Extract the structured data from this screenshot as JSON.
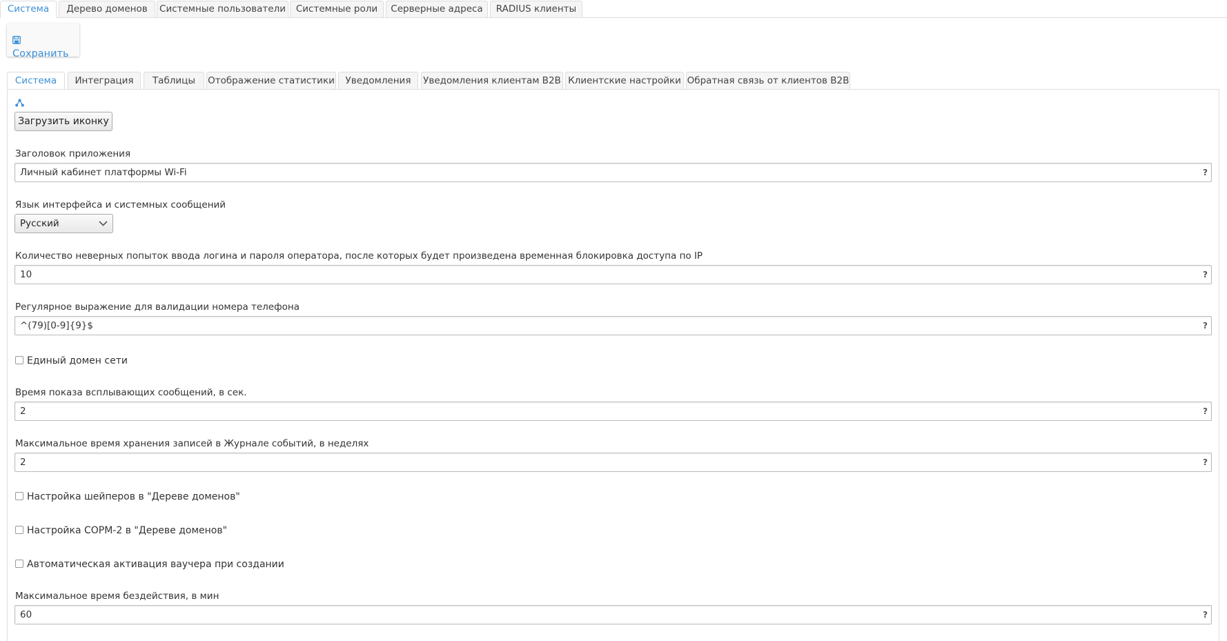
{
  "top_tabs": [
    "Система",
    "Дерево доменов",
    "Системные пользователи",
    "Системные роли",
    "Серверные адреса",
    "RADIUS клиенты"
  ],
  "toolbar": {
    "save_label": "Сохранить"
  },
  "sub_tabs": [
    "Система",
    "Интеграция",
    "Таблицы",
    "Отображение статистики",
    "Уведомления",
    "Уведомления клиентам B2B",
    "Клиентские настройки",
    "Обратная связь от клиентов B2B"
  ],
  "icon": {
    "upload_label": "Загрузить иконку"
  },
  "form": {
    "app_title": {
      "label": "Заголовок приложения",
      "value": "Личный кабинет платформы Wi-Fi"
    },
    "language": {
      "label": "Язык интерфейса и системных сообщений",
      "value": "Русский"
    },
    "login_attempts": {
      "label": "Количество неверных попыток ввода логина и пароля оператора, после которых будет произведена временная блокировка доступа по IP",
      "value": "10"
    },
    "phone_regex": {
      "label": "Регулярное выражение для валидации номера телефона",
      "value": "^(79)[0-9]{9}$"
    },
    "single_domain": {
      "label": "Единый домен сети",
      "checked": false
    },
    "popup_time": {
      "label": "Время показа всплывающих сообщений, в сек.",
      "value": "2"
    },
    "log_retention": {
      "label": "Максимальное время хранения записей в Журнале событий, в неделях",
      "value": "2"
    },
    "shapers": {
      "label": "Настройка шейперов в \"Дереве доменов\"",
      "checked": false
    },
    "sorm2": {
      "label": "Настройка СОРМ-2 в \"Дереве доменов\"",
      "checked": false
    },
    "voucher_autoactivate": {
      "label": "Автоматическая активация ваучера при создании",
      "checked": false
    },
    "idle_time": {
      "label": "Максимальное время бездействия, в мин",
      "value": "60"
    }
  },
  "help_mark": "?",
  "colors": {
    "accent": "#3a8fd6",
    "border": "#dddddd"
  }
}
